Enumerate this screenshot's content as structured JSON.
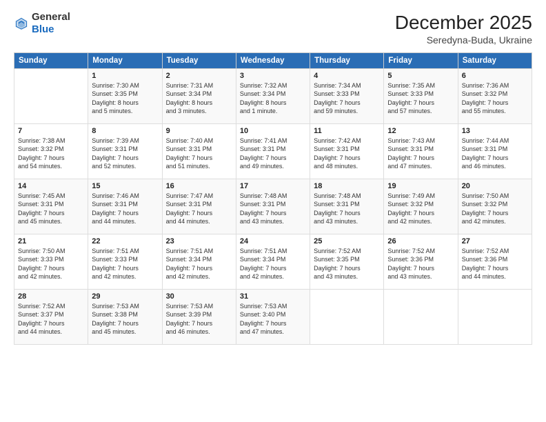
{
  "logo": {
    "general": "General",
    "blue": "Blue"
  },
  "title": "December 2025",
  "location": "Seredyna-Buda, Ukraine",
  "headers": [
    "Sunday",
    "Monday",
    "Tuesday",
    "Wednesday",
    "Thursday",
    "Friday",
    "Saturday"
  ],
  "weeks": [
    [
      {
        "day": "",
        "info": ""
      },
      {
        "day": "1",
        "info": "Sunrise: 7:30 AM\nSunset: 3:35 PM\nDaylight: 8 hours\nand 5 minutes."
      },
      {
        "day": "2",
        "info": "Sunrise: 7:31 AM\nSunset: 3:34 PM\nDaylight: 8 hours\nand 3 minutes."
      },
      {
        "day": "3",
        "info": "Sunrise: 7:32 AM\nSunset: 3:34 PM\nDaylight: 8 hours\nand 1 minute."
      },
      {
        "day": "4",
        "info": "Sunrise: 7:34 AM\nSunset: 3:33 PM\nDaylight: 7 hours\nand 59 minutes."
      },
      {
        "day": "5",
        "info": "Sunrise: 7:35 AM\nSunset: 3:33 PM\nDaylight: 7 hours\nand 57 minutes."
      },
      {
        "day": "6",
        "info": "Sunrise: 7:36 AM\nSunset: 3:32 PM\nDaylight: 7 hours\nand 55 minutes."
      }
    ],
    [
      {
        "day": "7",
        "info": "Sunrise: 7:38 AM\nSunset: 3:32 PM\nDaylight: 7 hours\nand 54 minutes."
      },
      {
        "day": "8",
        "info": "Sunrise: 7:39 AM\nSunset: 3:31 PM\nDaylight: 7 hours\nand 52 minutes."
      },
      {
        "day": "9",
        "info": "Sunrise: 7:40 AM\nSunset: 3:31 PM\nDaylight: 7 hours\nand 51 minutes."
      },
      {
        "day": "10",
        "info": "Sunrise: 7:41 AM\nSunset: 3:31 PM\nDaylight: 7 hours\nand 49 minutes."
      },
      {
        "day": "11",
        "info": "Sunrise: 7:42 AM\nSunset: 3:31 PM\nDaylight: 7 hours\nand 48 minutes."
      },
      {
        "day": "12",
        "info": "Sunrise: 7:43 AM\nSunset: 3:31 PM\nDaylight: 7 hours\nand 47 minutes."
      },
      {
        "day": "13",
        "info": "Sunrise: 7:44 AM\nSunset: 3:31 PM\nDaylight: 7 hours\nand 46 minutes."
      }
    ],
    [
      {
        "day": "14",
        "info": "Sunrise: 7:45 AM\nSunset: 3:31 PM\nDaylight: 7 hours\nand 45 minutes."
      },
      {
        "day": "15",
        "info": "Sunrise: 7:46 AM\nSunset: 3:31 PM\nDaylight: 7 hours\nand 44 minutes."
      },
      {
        "day": "16",
        "info": "Sunrise: 7:47 AM\nSunset: 3:31 PM\nDaylight: 7 hours\nand 44 minutes."
      },
      {
        "day": "17",
        "info": "Sunrise: 7:48 AM\nSunset: 3:31 PM\nDaylight: 7 hours\nand 43 minutes."
      },
      {
        "day": "18",
        "info": "Sunrise: 7:48 AM\nSunset: 3:31 PM\nDaylight: 7 hours\nand 43 minutes."
      },
      {
        "day": "19",
        "info": "Sunrise: 7:49 AM\nSunset: 3:32 PM\nDaylight: 7 hours\nand 42 minutes."
      },
      {
        "day": "20",
        "info": "Sunrise: 7:50 AM\nSunset: 3:32 PM\nDaylight: 7 hours\nand 42 minutes."
      }
    ],
    [
      {
        "day": "21",
        "info": "Sunrise: 7:50 AM\nSunset: 3:33 PM\nDaylight: 7 hours\nand 42 minutes."
      },
      {
        "day": "22",
        "info": "Sunrise: 7:51 AM\nSunset: 3:33 PM\nDaylight: 7 hours\nand 42 minutes."
      },
      {
        "day": "23",
        "info": "Sunrise: 7:51 AM\nSunset: 3:34 PM\nDaylight: 7 hours\nand 42 minutes."
      },
      {
        "day": "24",
        "info": "Sunrise: 7:51 AM\nSunset: 3:34 PM\nDaylight: 7 hours\nand 42 minutes."
      },
      {
        "day": "25",
        "info": "Sunrise: 7:52 AM\nSunset: 3:35 PM\nDaylight: 7 hours\nand 43 minutes."
      },
      {
        "day": "26",
        "info": "Sunrise: 7:52 AM\nSunset: 3:36 PM\nDaylight: 7 hours\nand 43 minutes."
      },
      {
        "day": "27",
        "info": "Sunrise: 7:52 AM\nSunset: 3:36 PM\nDaylight: 7 hours\nand 44 minutes."
      }
    ],
    [
      {
        "day": "28",
        "info": "Sunrise: 7:52 AM\nSunset: 3:37 PM\nDaylight: 7 hours\nand 44 minutes."
      },
      {
        "day": "29",
        "info": "Sunrise: 7:53 AM\nSunset: 3:38 PM\nDaylight: 7 hours\nand 45 minutes."
      },
      {
        "day": "30",
        "info": "Sunrise: 7:53 AM\nSunset: 3:39 PM\nDaylight: 7 hours\nand 46 minutes."
      },
      {
        "day": "31",
        "info": "Sunrise: 7:53 AM\nSunset: 3:40 PM\nDaylight: 7 hours\nand 47 minutes."
      },
      {
        "day": "",
        "info": ""
      },
      {
        "day": "",
        "info": ""
      },
      {
        "day": "",
        "info": ""
      }
    ]
  ]
}
